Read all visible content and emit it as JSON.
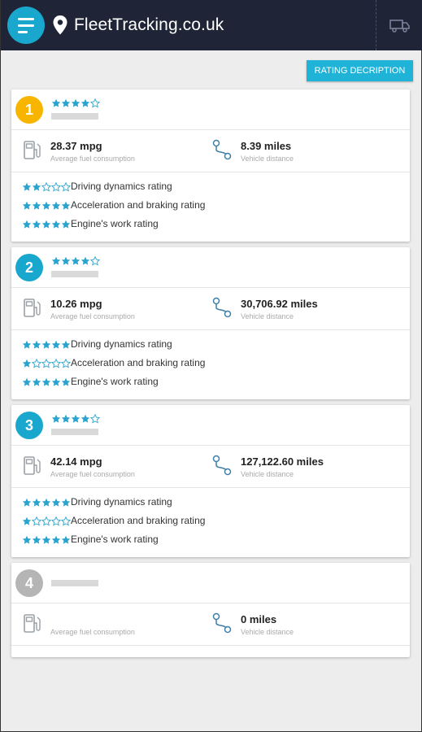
{
  "app": {
    "title": "FleetTracking.co.uk"
  },
  "colors": {
    "header_bg": "#1f2436",
    "accent": "#19a7cd",
    "rank1": "#f7b500",
    "rank_active": "#19a7cd",
    "rank_inactive": "#b5b5b5",
    "star": "#2aa4cf"
  },
  "toolbar": {
    "rating_description_label": "RATING DECRIPTION"
  },
  "labels": {
    "fuel": "Average fuel consumption",
    "distance": "Vehicle distance"
  },
  "vehicles": [
    {
      "rank": "1",
      "rank_color": "#f7b500",
      "overall_stars": 4,
      "mpg": "28.37 mpg",
      "distance": "8.39 miles",
      "ratings": [
        {
          "label": "Driving dynamics rating",
          "stars": 2
        },
        {
          "label": "Acceleration and braking rating",
          "stars": 5
        },
        {
          "label": "Engine's work rating",
          "stars": 5
        }
      ]
    },
    {
      "rank": "2",
      "rank_color": "#19a7cd",
      "overall_stars": 4,
      "mpg": "10.26 mpg",
      "distance": "30,706.92 miles",
      "ratings": [
        {
          "label": "Driving dynamics rating",
          "stars": 5
        },
        {
          "label": "Acceleration and braking rating",
          "stars": 1
        },
        {
          "label": "Engine's work rating",
          "stars": 5
        }
      ]
    },
    {
      "rank": "3",
      "rank_color": "#19a7cd",
      "overall_stars": 4,
      "mpg": "42.14 mpg",
      "distance": "127,122.60 miles",
      "ratings": [
        {
          "label": "Driving dynamics rating",
          "stars": 5
        },
        {
          "label": "Acceleration and braking rating",
          "stars": 1
        },
        {
          "label": "Engine's work rating",
          "stars": 5
        }
      ]
    },
    {
      "rank": "4",
      "rank_color": "#b5b5b5",
      "mpg": "",
      "distance": "0 miles"
    }
  ]
}
